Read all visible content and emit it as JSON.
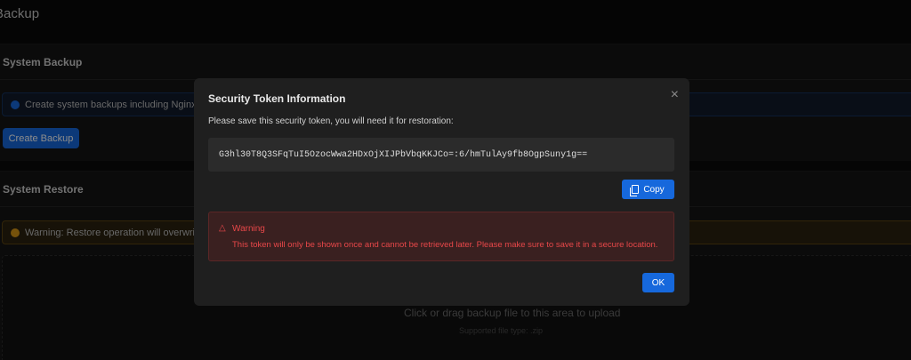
{
  "page": {
    "title": "Backup"
  },
  "backup": {
    "header": "System Backup",
    "info": "Create system backups including Nginx confi",
    "button": "Create Backup"
  },
  "restore": {
    "header": "System Restore",
    "warning": "Warning: Restore operation will overwrite cur",
    "drop_text": "Click or drag backup file to this area to upload",
    "drop_sub": "Supported file type: .zip"
  },
  "modal": {
    "title": "Security Token Information",
    "close": "×",
    "description": "Please save this security token, you will need it for restoration:",
    "token": "G3hl30T8Q3SFqTuI5OzocWwa2HDxOjXIJPbVbqKKJCo=:6/hmTulAy9fb8OgpSuny1g==",
    "copy": "Copy",
    "warning_title": "Warning",
    "warning_text": "This token will only be shown once and cannot be retrieved later. Please make sure to save it in a secure location.",
    "ok": "OK"
  }
}
